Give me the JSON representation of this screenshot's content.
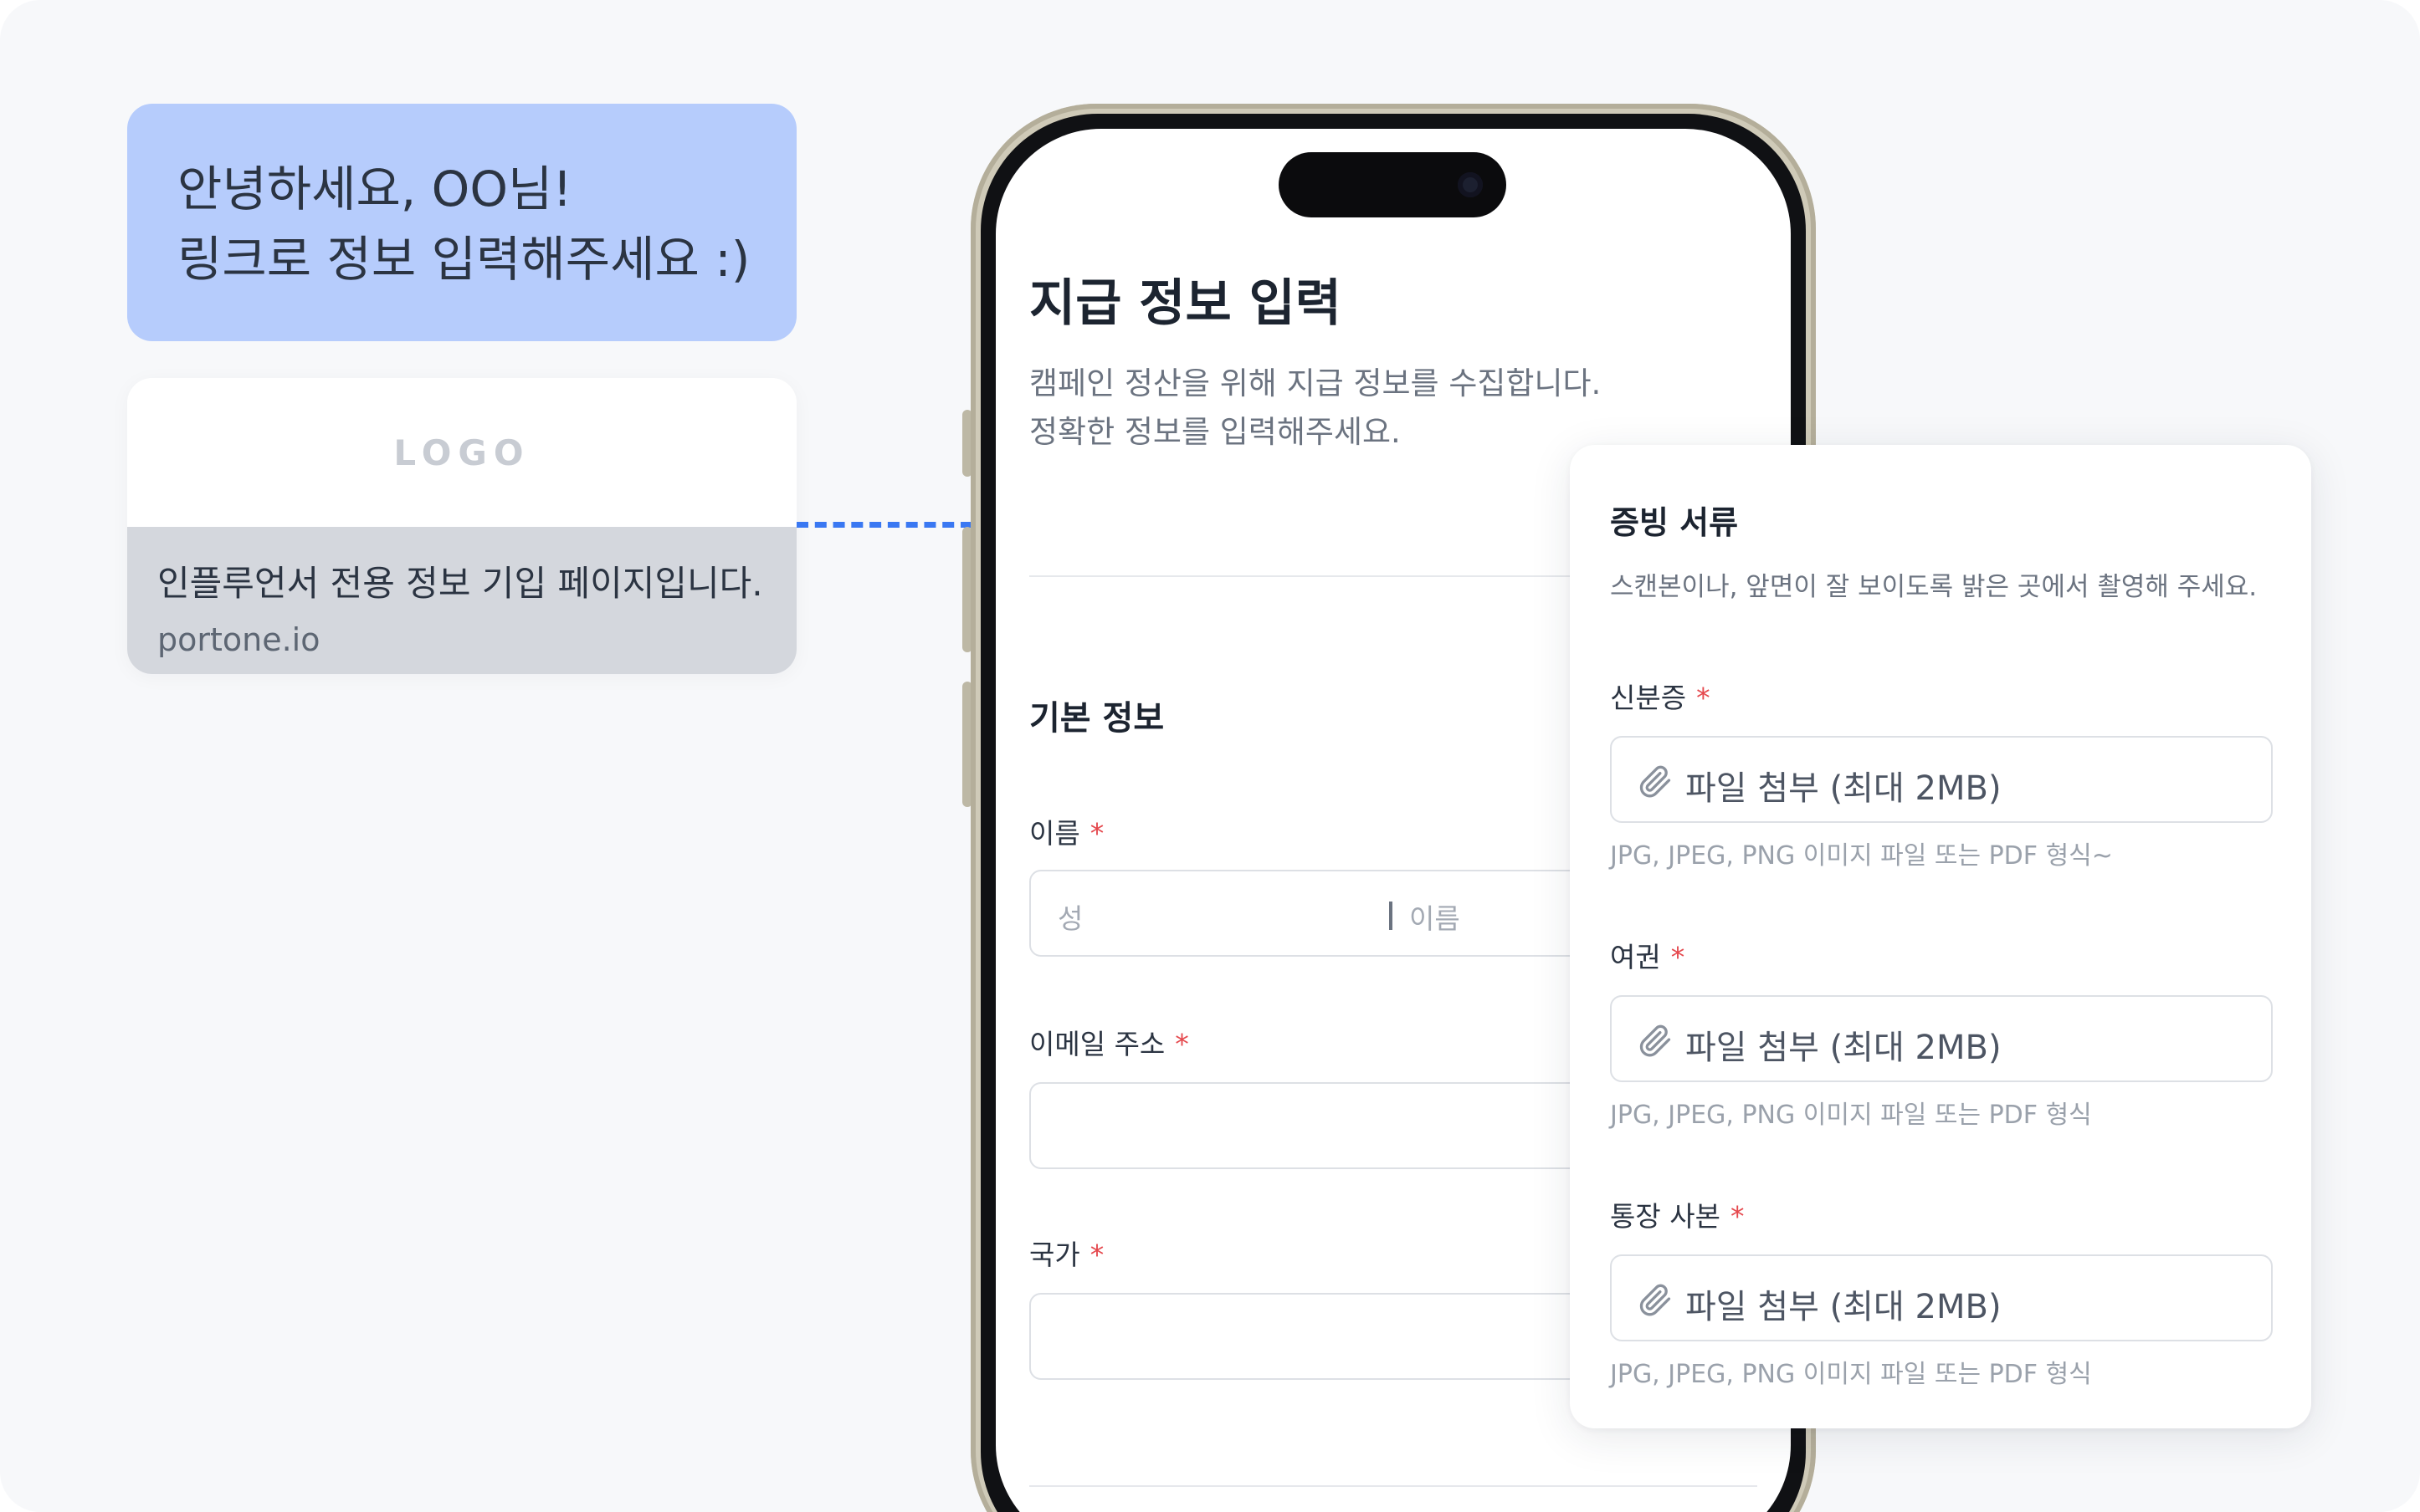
{
  "chat": {
    "line1": "안녕하세요, OO님!",
    "line2": "링크로 정보 입력해주세요 :)"
  },
  "link_preview": {
    "logo": "LOGO",
    "title": "인플루언서 전용 정보 기입 페이지입니다.",
    "domain": "portone.io"
  },
  "form": {
    "title": "지급 정보 입력",
    "desc_line1": "캠페인 정산을 위해 지급 정보를 수집합니다.",
    "desc_line2": "정확한 정보를 입력해주세요.",
    "section_basic": "기본 정보",
    "name_label": "이름",
    "name_first_placeholder": "성",
    "name_last_placeholder": "이름",
    "email_label": "이메일 주소",
    "country_label": "국가",
    "required_mark": "*"
  },
  "documents": {
    "title": "증빙 서류",
    "desc": "스캔본이나, 앞면이 잘 보이도록 밝은 곳에서 촬영해 주세요.",
    "items": [
      {
        "label": "신분증",
        "button": "파일 첨부 (최대 2MB)",
        "hint": "JPG, JPEG, PNG 이미지 파일 또는 PDF 형식~"
      },
      {
        "label": "여권",
        "button": "파일 첨부 (최대 2MB)",
        "hint": "JPG, JPEG, PNG 이미지 파일 또는 PDF 형식"
      },
      {
        "label": "통장 사본",
        "button": "파일 첨부 (최대 2MB)",
        "hint": "JPG, JPEG, PNG 이미지 파일 또는 PDF 형식"
      }
    ]
  },
  "colors": {
    "bubble": "#b6ccfc",
    "accent_dashed": "#3a78f2",
    "required": "#e5484d"
  },
  "icons": {
    "attachment": "paperclip-icon"
  }
}
